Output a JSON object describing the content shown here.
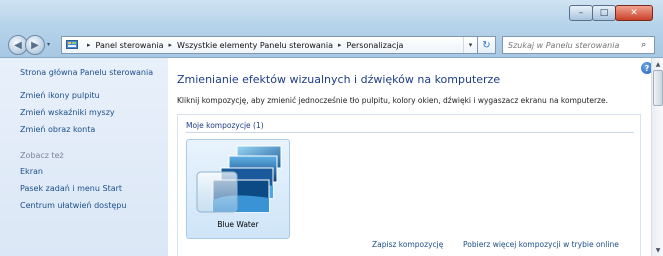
{
  "window": {
    "controls": {
      "minimize": "–",
      "maximize": "□",
      "close": "✕"
    }
  },
  "nav": {
    "back_icon": "back-arrow-icon",
    "forward_icon": "forward-arrow-icon",
    "dropdown_icon": "chevron-down-icon"
  },
  "address": {
    "icon": "control-panel-icon",
    "crumbs": [
      "Panel sterowania",
      "Wszystkie elementy Panelu sterowania",
      "Personalizacja"
    ],
    "separator": "▸",
    "dropdown": "▾",
    "refresh": "↻"
  },
  "search": {
    "placeholder": "Szukaj w Panelu sterowania",
    "icon": "⌕"
  },
  "sidebar": {
    "home": "Strona główna Panelu sterowania",
    "tasks": [
      "Zmień ikony pulpitu",
      "Zmień wskaźniki myszy",
      "Zmień obraz konta"
    ],
    "see_also_heading": "Zobacz też",
    "see_also": [
      "Ekran",
      "Pasek zadań i menu Start",
      "Centrum ułatwień dostępu"
    ]
  },
  "main": {
    "help_icon": "?",
    "title": "Zmienianie efektów wizualnych i dźwięków na komputerze",
    "description": "Kliknij kompozycję, aby zmienić jednocześnie tło pulpitu, kolory okien, dźwięki i wygaszacz ekranu na komputerze.",
    "section_header": "Moje kompozycje (1)",
    "themes": [
      {
        "name": "Blue Water"
      }
    ],
    "links": {
      "save": "Zapisz kompozycję",
      "more": "Pobierz więcej kompozycji w trybie online"
    }
  },
  "colors": {
    "accent_title": "#1e3d87",
    "link": "#1b4f8a",
    "sidebar_bg": "#dbe7f6"
  },
  "scrollbar": {
    "up": "▲",
    "down": "▼"
  }
}
